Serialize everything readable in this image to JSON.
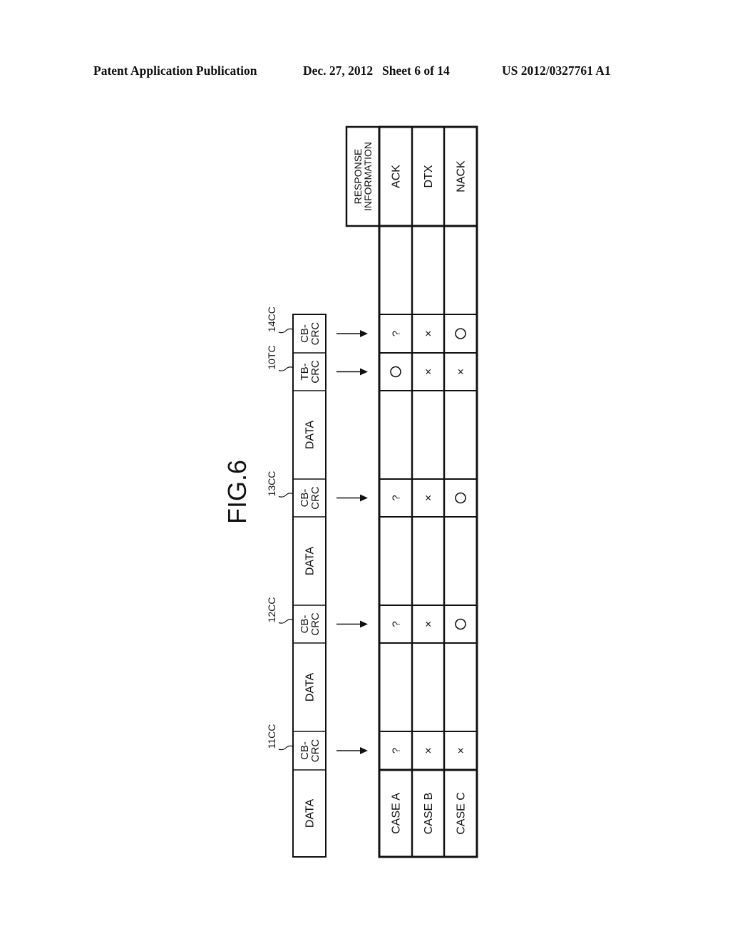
{
  "header": {
    "publication_type": "Patent Application Publication",
    "date": "Dec. 27, 2012",
    "sheet": "Sheet 6 of 14",
    "publication_number": "US 2012/0327761 A1"
  },
  "figure": {
    "title": "FIG.6",
    "transport_block": {
      "segments": [
        {
          "label": "DATA",
          "ref": ""
        },
        {
          "label": "CB-\nCRC",
          "ref": "11CC"
        },
        {
          "label": "DATA",
          "ref": ""
        },
        {
          "label": "CB-\nCRC",
          "ref": "12CC"
        },
        {
          "label": "DATA",
          "ref": ""
        },
        {
          "label": "CB-\nCRC",
          "ref": "13CC"
        },
        {
          "label": "DATA",
          "ref": ""
        },
        {
          "label": "TB-\nCRC",
          "ref": "10TC"
        },
        {
          "label": "CB-\nCRC",
          "ref": "14CC"
        }
      ]
    },
    "table": {
      "cases": [
        "CASE A",
        "CASE B",
        "CASE C"
      ],
      "response_header": "RESPONSE\nINFORMATION",
      "responses": [
        "ACK",
        "DTX",
        "NACK"
      ],
      "check_columns": [
        {
          "ref": "11CC",
          "values": [
            "?",
            "×",
            "×"
          ]
        },
        {
          "ref": "12CC",
          "values": [
            "?",
            "×",
            "○"
          ]
        },
        {
          "ref": "13CC",
          "values": [
            "?",
            "×",
            "○"
          ]
        },
        {
          "ref": "10TC",
          "values": [
            "○",
            "×",
            "×"
          ]
        },
        {
          "ref": "14CC",
          "values": [
            "?",
            "×",
            "○"
          ]
        }
      ]
    }
  }
}
